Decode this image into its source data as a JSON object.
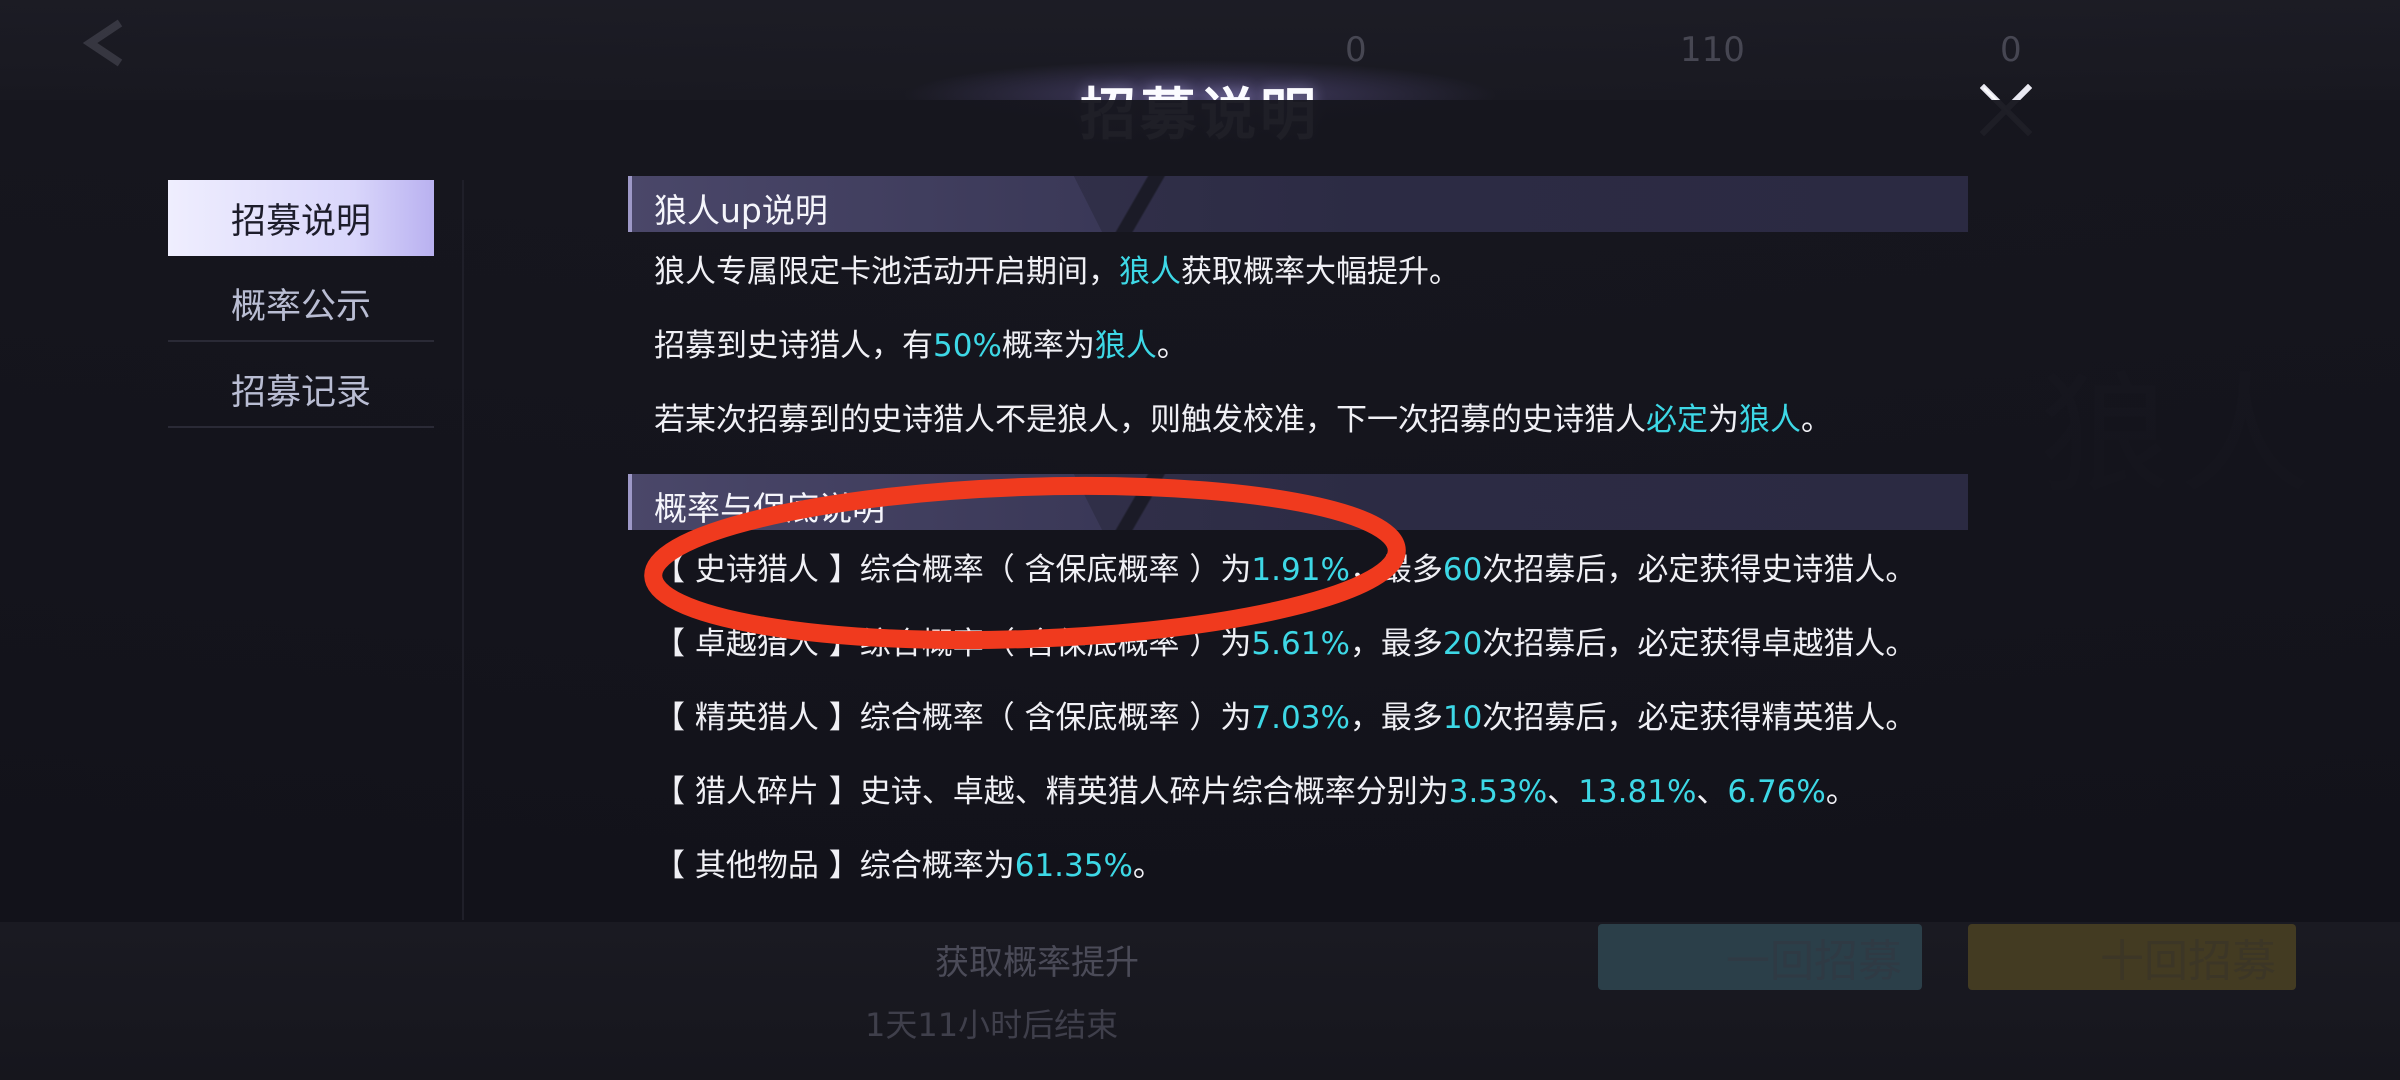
{
  "modal": {
    "title": "招募说明",
    "close_icon": "close-icon"
  },
  "nav": {
    "items": [
      {
        "label": "招募说明",
        "active": true
      },
      {
        "label": "概率公示",
        "active": false
      },
      {
        "label": "招募记录",
        "active": false
      }
    ]
  },
  "sections": {
    "up": {
      "title": "狼人up说明",
      "p1": {
        "a": "狼人专属限定卡池活动开启期间，",
        "b": "狼人",
        "c": "获取概率大幅提升。"
      },
      "p2": {
        "a": "招募到史诗猎人，有",
        "b": "50%",
        "c": "概率为",
        "d": "狼人",
        "e": "。"
      },
      "p3": {
        "a": "若某次招募到的史诗猎人不是狼人，则触发校准，下一次招募的史诗猎人",
        "b": "必定",
        "c": "为",
        "d": "狼人",
        "e": "。"
      }
    },
    "prob": {
      "title": "概率与保底说明",
      "rows": [
        {
          "a": "【 史诗猎人 】综合概率（ 含保底概率 ）为",
          "b": "1.91%",
          "c": "，最多",
          "d": "60",
          "e": "次招募后，必定获得史诗猎人。"
        },
        {
          "a": "【 卓越猎人 】综合概率（ 含保底概率 ）为",
          "b": "5.61%",
          "c": "，最多",
          "d": "20",
          "e": "次招募后，必定获得卓越猎人。"
        },
        {
          "a": "【 精英猎人 】综合概率（ 含保底概率 ）为",
          "b": "7.03%",
          "c": "，最多",
          "d": "10",
          "e": "次招募后，必定获得精英猎人。"
        }
      ],
      "shards": {
        "a": "【 猎人碎片 】史诗、卓越、精英猎人碎片综合概率分别为",
        "v1": "3.53%",
        "s1": "、",
        "v2": "13.81%",
        "s2": "、",
        "v3": "6.76%",
        "end": "。"
      },
      "other": {
        "a": "【 其他物品 】综合概率为",
        "b": "61.35%",
        "c": "。"
      }
    }
  },
  "background": {
    "bg_wolf_text": "狼人",
    "info_line": "获取概率提升",
    "timer": "1天11小时后结束",
    "btn_one": "一回招募",
    "btn_ten": "十回招募",
    "res1": "0",
    "res2": "110",
    "res3": "0"
  },
  "colors": {
    "highlight": "#3dd8e6",
    "annotation": "#f03a1e",
    "active_tab": "#e6e4fc"
  }
}
